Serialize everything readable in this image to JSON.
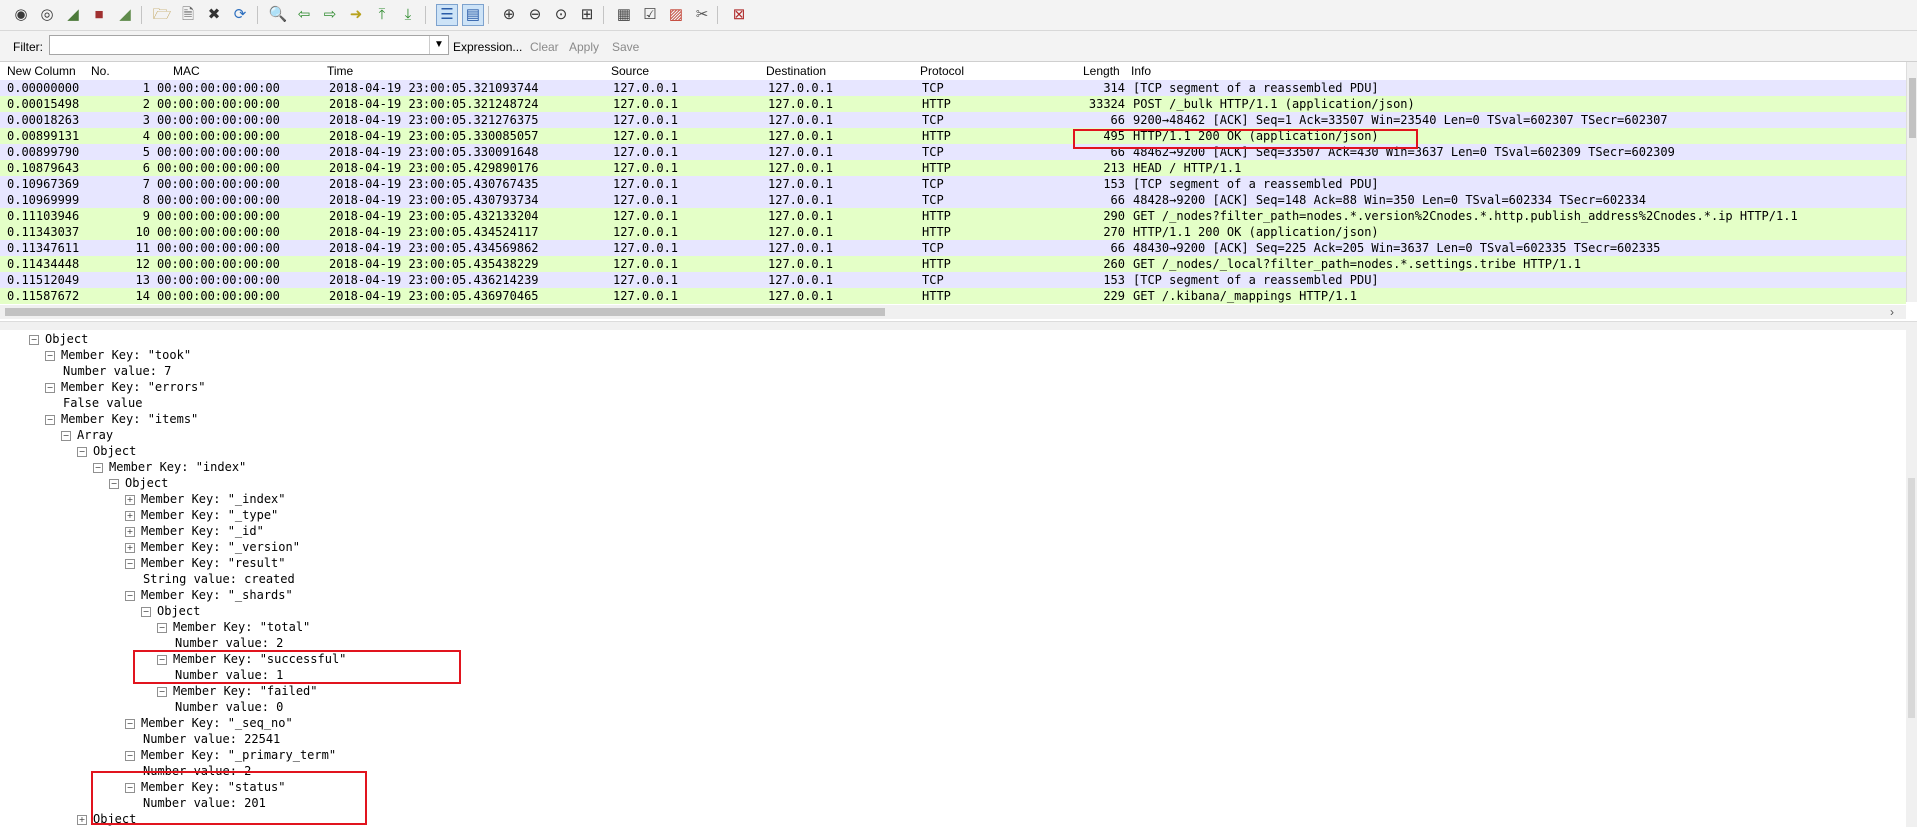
{
  "toolbar": {
    "icons": [
      "start-capture-icon",
      "capture-options-icon",
      "shark-fin-icon",
      "stop-capture-icon",
      "restart-capture-icon",
      "open-file-icon",
      "save-file-icon",
      "close-file-icon",
      "reload-file-icon",
      "find-packet-icon",
      "go-back-icon",
      "go-forward-icon",
      "go-to-packet-icon",
      "go-first-icon",
      "go-last-icon",
      "autoscroll-icon",
      "colorize-icon",
      "zoom-in-icon",
      "zoom-out-icon",
      "normal-size-icon",
      "resize-columns-icon",
      "capture-filters-icon",
      "display-filters-icon",
      "coloring-rules-icon",
      "preferences-icon",
      "help-icon"
    ]
  },
  "filter": {
    "label": "Filter:",
    "value": "",
    "expression": "Expression...",
    "clear": "Clear",
    "apply": "Apply",
    "save": "Save"
  },
  "packet_list": {
    "columns": [
      "New Column",
      "No.",
      "MAC",
      "Time",
      "Source",
      "Destination",
      "Protocol",
      "Length",
      "Info"
    ],
    "rows": [
      {
        "newcol": "0.00000000",
        "no": "1",
        "mac": "00:00:00:00:00:00",
        "time": "2018-04-19 23:00:05.321093744",
        "src": "127.0.0.1",
        "dst": "127.0.0.1",
        "proto": "TCP",
        "len": "314",
        "info": "[TCP segment of a reassembled PDU]"
      },
      {
        "newcol": "0.00015498",
        "no": "2",
        "mac": "00:00:00:00:00:00",
        "time": "2018-04-19 23:00:05.321248724",
        "src": "127.0.0.1",
        "dst": "127.0.0.1",
        "proto": "HTTP",
        "len": "33324",
        "info": "POST /_bulk HTTP/1.1  (application/json)"
      },
      {
        "newcol": "0.00018263",
        "no": "3",
        "mac": "00:00:00:00:00:00",
        "time": "2018-04-19 23:00:05.321276375",
        "src": "127.0.0.1",
        "dst": "127.0.0.1",
        "proto": "TCP",
        "len": "66",
        "info": "9200→48462 [ACK] Seq=1 Ack=33507 Win=23540 Len=0 TSval=602307 TSecr=602307"
      },
      {
        "newcol": "0.00899131",
        "no": "4",
        "mac": "00:00:00:00:00:00",
        "time": "2018-04-19 23:00:05.330085057",
        "src": "127.0.0.1",
        "dst": "127.0.0.1",
        "proto": "HTTP",
        "len": "495",
        "info": "HTTP/1.1 200 OK  (application/json)"
      },
      {
        "newcol": "0.00899790",
        "no": "5",
        "mac": "00:00:00:00:00:00",
        "time": "2018-04-19 23:00:05.330091648",
        "src": "127.0.0.1",
        "dst": "127.0.0.1",
        "proto": "TCP",
        "len": "66",
        "info": "48462→9200 [ACK] Seq=33507 Ack=430 Win=3637 Len=0 TSval=602309 TSecr=602309"
      },
      {
        "newcol": "0.10879643",
        "no": "6",
        "mac": "00:00:00:00:00:00",
        "time": "2018-04-19 23:00:05.429890176",
        "src": "127.0.0.1",
        "dst": "127.0.0.1",
        "proto": "HTTP",
        "len": "213",
        "info": "HEAD / HTTP/1.1"
      },
      {
        "newcol": "0.10967369",
        "no": "7",
        "mac": "00:00:00:00:00:00",
        "time": "2018-04-19 23:00:05.430767435",
        "src": "127.0.0.1",
        "dst": "127.0.0.1",
        "proto": "TCP",
        "len": "153",
        "info": "[TCP segment of a reassembled PDU]"
      },
      {
        "newcol": "0.10969999",
        "no": "8",
        "mac": "00:00:00:00:00:00",
        "time": "2018-04-19 23:00:05.430793734",
        "src": "127.0.0.1",
        "dst": "127.0.0.1",
        "proto": "TCP",
        "len": "66",
        "info": "48428→9200 [ACK] Seq=148 Ack=88 Win=350 Len=0 TSval=602334 TSecr=602334"
      },
      {
        "newcol": "0.11103946",
        "no": "9",
        "mac": "00:00:00:00:00:00",
        "time": "2018-04-19 23:00:05.432133204",
        "src": "127.0.0.1",
        "dst": "127.0.0.1",
        "proto": "HTTP",
        "len": "290",
        "info": "GET /_nodes?filter_path=nodes.*.version%2Cnodes.*.http.publish_address%2Cnodes.*.ip HTTP/1.1"
      },
      {
        "newcol": "0.11343037",
        "no": "10",
        "mac": "00:00:00:00:00:00",
        "time": "2018-04-19 23:00:05.434524117",
        "src": "127.0.0.1",
        "dst": "127.0.0.1",
        "proto": "HTTP",
        "len": "270",
        "info": "HTTP/1.1 200 OK  (application/json)"
      },
      {
        "newcol": "0.11347611",
        "no": "11",
        "mac": "00:00:00:00:00:00",
        "time": "2018-04-19 23:00:05.434569862",
        "src": "127.0.0.1",
        "dst": "127.0.0.1",
        "proto": "TCP",
        "len": "66",
        "info": "48430→9200 [ACK] Seq=225 Ack=205 Win=3637 Len=0 TSval=602335 TSecr=602335"
      },
      {
        "newcol": "0.11434448",
        "no": "12",
        "mac": "00:00:00:00:00:00",
        "time": "2018-04-19 23:00:05.435438229",
        "src": "127.0.0.1",
        "dst": "127.0.0.1",
        "proto": "HTTP",
        "len": "260",
        "info": "GET /_nodes/_local?filter_path=nodes.*.settings.tribe HTTP/1.1"
      },
      {
        "newcol": "0.11512049",
        "no": "13",
        "mac": "00:00:00:00:00:00",
        "time": "2018-04-19 23:00:05.436214239",
        "src": "127.0.0.1",
        "dst": "127.0.0.1",
        "proto": "TCP",
        "len": "153",
        "info": "[TCP segment of a reassembled PDU]"
      },
      {
        "newcol": "0.11587672",
        "no": "14",
        "mac": "00:00:00:00:00:00",
        "time": "2018-04-19 23:00:05.436970465",
        "src": "127.0.0.1",
        "dst": "127.0.0.1",
        "proto": "HTTP",
        "len": "229",
        "info": "GET /.kibana/_mappings HTTP/1.1"
      }
    ]
  },
  "tree": [
    {
      "lvl": 0,
      "exp": "−",
      "text": "Object"
    },
    {
      "lvl": 1,
      "exp": "−",
      "text": "Member Key: \"took\""
    },
    {
      "lvl": 2,
      "exp": "",
      "text": "Number value: 7"
    },
    {
      "lvl": 1,
      "exp": "−",
      "text": "Member Key: \"errors\""
    },
    {
      "lvl": 2,
      "exp": "",
      "text": "False value"
    },
    {
      "lvl": 1,
      "exp": "−",
      "text": "Member Key: \"items\""
    },
    {
      "lvl": 2,
      "exp": "−",
      "text": "Array"
    },
    {
      "lvl": 3,
      "exp": "−",
      "text": "Object"
    },
    {
      "lvl": 4,
      "exp": "−",
      "text": "Member Key: \"index\""
    },
    {
      "lvl": 5,
      "exp": "−",
      "text": "Object"
    },
    {
      "lvl": 6,
      "exp": "+",
      "text": "Member Key: \"_index\""
    },
    {
      "lvl": 6,
      "exp": "+",
      "text": "Member Key: \"_type\""
    },
    {
      "lvl": 6,
      "exp": "+",
      "text": "Member Key: \"_id\""
    },
    {
      "lvl": 6,
      "exp": "+",
      "text": "Member Key: \"_version\""
    },
    {
      "lvl": 6,
      "exp": "−",
      "text": "Member Key: \"result\""
    },
    {
      "lvl": 7,
      "exp": "",
      "text": "String value: created"
    },
    {
      "lvl": 6,
      "exp": "−",
      "text": "Member Key: \"_shards\""
    },
    {
      "lvl": 7,
      "exp": "−",
      "text": "Object"
    },
    {
      "lvl": 8,
      "exp": "−",
      "text": "Member Key: \"total\""
    },
    {
      "lvl": 9,
      "exp": "",
      "text": "Number value: 2"
    },
    {
      "lvl": 8,
      "exp": "−",
      "text": "Member Key: \"successful\""
    },
    {
      "lvl": 9,
      "exp": "",
      "text": "Number value: 1"
    },
    {
      "lvl": 8,
      "exp": "−",
      "text": "Member Key: \"failed\""
    },
    {
      "lvl": 9,
      "exp": "",
      "text": "Number value: 0"
    },
    {
      "lvl": 6,
      "exp": "−",
      "text": "Member Key: \"_seq_no\""
    },
    {
      "lvl": 7,
      "exp": "",
      "text": "Number value: 22541"
    },
    {
      "lvl": 6,
      "exp": "−",
      "text": "Member Key: \"_primary_term\""
    },
    {
      "lvl": 7,
      "exp": "",
      "text": "Number value: 2"
    },
    {
      "lvl": 6,
      "exp": "−",
      "text": "Member Key: \"status\""
    },
    {
      "lvl": 7,
      "exp": "",
      "text": "Number value: 201"
    },
    {
      "lvl": 3,
      "exp": "+",
      "text": "Object"
    }
  ],
  "colors": {
    "http_row": "#e4ffc7",
    "tcp_row": "#e7e6ff",
    "highlight": "#e1141e"
  }
}
